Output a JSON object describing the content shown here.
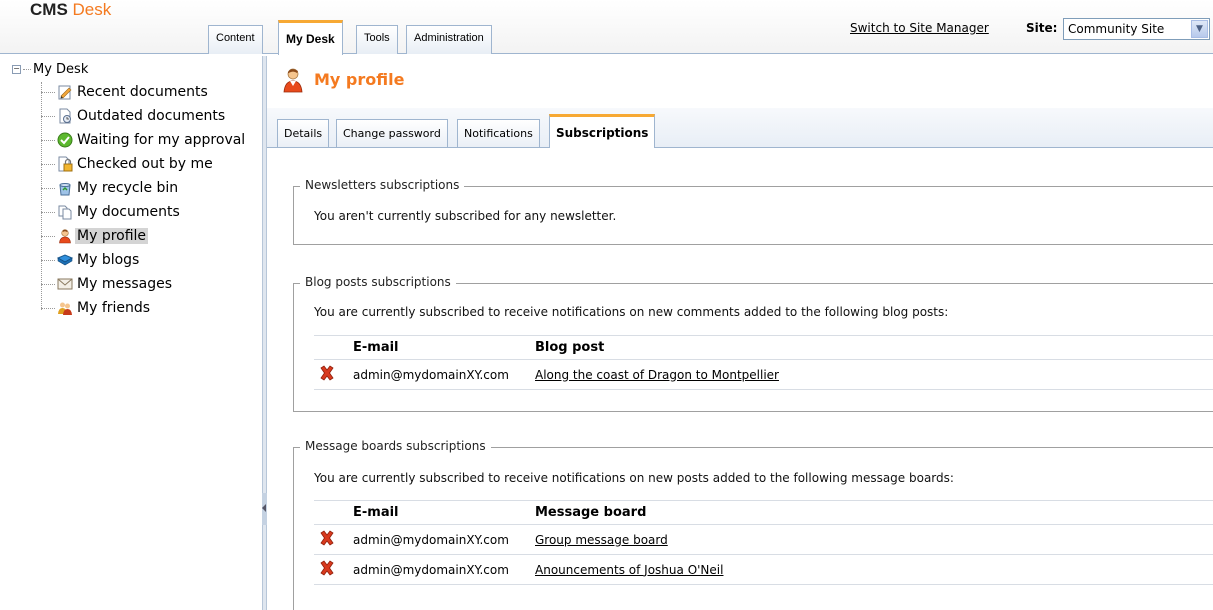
{
  "header": {
    "logo_cms": "CMS",
    "logo_desk": "Desk",
    "tabs": [
      {
        "label": "Content",
        "active": false
      },
      {
        "label": "My Desk",
        "active": true
      },
      {
        "label": "Tools",
        "active": false
      },
      {
        "label": "Administration",
        "active": false
      }
    ],
    "switch_link": "Switch to Site Manager",
    "site_label": "Site:",
    "site_value": "Community Site"
  },
  "tree": {
    "root": "My Desk",
    "root_expander": "−",
    "items": [
      {
        "label": "Recent documents",
        "icon": "recent-documents-icon"
      },
      {
        "label": "Outdated documents",
        "icon": "outdated-documents-icon"
      },
      {
        "label": "Waiting for my approval",
        "icon": "approval-check-icon"
      },
      {
        "label": "Checked out by me",
        "icon": "checked-out-lock-icon"
      },
      {
        "label": "My recycle bin",
        "icon": "recycle-bin-icon"
      },
      {
        "label": "My documents",
        "icon": "documents-icon"
      },
      {
        "label": "My profile",
        "icon": "user-profile-icon",
        "selected": true
      },
      {
        "label": "My blogs",
        "icon": "blog-book-icon"
      },
      {
        "label": "My messages",
        "icon": "envelope-icon"
      },
      {
        "label": "My friends",
        "icon": "friends-icon"
      }
    ]
  },
  "page": {
    "title": "My profile",
    "subtabs": [
      {
        "label": "Details",
        "active": false
      },
      {
        "label": "Change password",
        "active": false
      },
      {
        "label": "Notifications",
        "active": false
      },
      {
        "label": "Subscriptions",
        "active": true
      }
    ]
  },
  "newsletters": {
    "legend": "Newsletters subscriptions",
    "message": "You aren't currently subscribed for any newsletter."
  },
  "blogs": {
    "legend": "Blog posts subscriptions",
    "message": "You are currently subscribed to receive notifications on new comments added to the following blog posts:",
    "columns": [
      "E-mail",
      "Blog post"
    ],
    "rows": [
      {
        "email": "admin@mydomainXY.com",
        "item": "Along the coast of Dragon to Montpellier"
      }
    ]
  },
  "boards": {
    "legend": "Message boards subscriptions",
    "message": "You are currently subscribed to receive notifications on new posts added to the following message boards:",
    "columns": [
      "E-mail",
      "Message board"
    ],
    "rows": [
      {
        "email": "admin@mydomainXY.com",
        "item": "Group message board"
      },
      {
        "email": "admin@mydomainXY.com",
        "item": "Anouncements of Joshua O'Neil"
      }
    ]
  },
  "colors": {
    "accent": "#f47a20",
    "tab_highlight": "#f7a934",
    "delete_red": "#d83a1f"
  }
}
